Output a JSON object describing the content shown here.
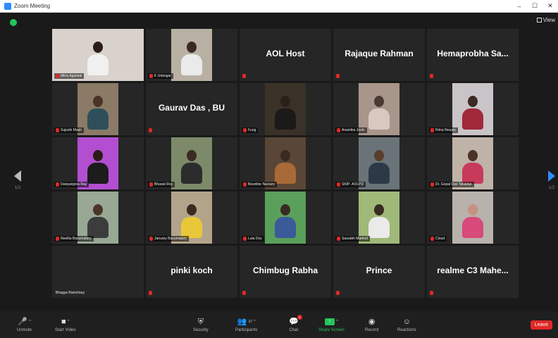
{
  "window": {
    "title": "Zoom Meeting",
    "minimize": "–",
    "maximize": "☐",
    "close": "✕"
  },
  "view_label": "View",
  "pager": {
    "left_num": "1/2",
    "right_num": "1/2"
  },
  "tiles": [
    {
      "name": "Mitra Agarwal",
      "type": "video",
      "active": true,
      "bg": "#d9d2cc",
      "body": "#f0f0f0",
      "head": "#2a1c16"
    },
    {
      "name": "K Udangar",
      "type": "video",
      "bg": "#b9b0a4",
      "body": "#eaeaea",
      "head": "#3b2a22"
    },
    {
      "name": "AOL Host",
      "type": "text"
    },
    {
      "name": "Rajaque Rahman",
      "type": "text"
    },
    {
      "name": "Hemaprobha  Sa...",
      "type": "text"
    },
    {
      "name": "Sujoshi Mash",
      "type": "video",
      "bg": "#8a7a66",
      "body": "#2e4f5a",
      "head": "#4a3426"
    },
    {
      "name": "Gaurav Das , BU",
      "type": "text"
    },
    {
      "name": "Fuog",
      "type": "video",
      "bg": "#3a3228",
      "body": "#1c1a18",
      "head": "#2a211b"
    },
    {
      "name": "Anamika Joshi",
      "type": "video",
      "bg": "#a8968a",
      "body": "#d8c8c0",
      "head": "#4a3a32"
    },
    {
      "name": "Rima Neuaty",
      "type": "video",
      "bg": "#c9c4c7",
      "body": "#a02838",
      "head": "#3a2a24"
    },
    {
      "name": "Deepanjona Ray",
      "type": "video",
      "bg": "#b24fd0",
      "body": "#1c1c1c",
      "head": "#2a1c18"
    },
    {
      "name": "Bharati Roy",
      "type": "video",
      "bg": "#7c8a6a",
      "body": "#2c2c2c",
      "head": "#3a2a22"
    },
    {
      "name": "Bewdine Narzary",
      "type": "video",
      "bg": "#5a4636",
      "body": "#a86a38",
      "head": "#3a2a20"
    },
    {
      "name": "SKIP- AOLPD",
      "type": "video",
      "bg": "#6a7478",
      "body": "#2c3a48",
      "head": "#5a3e2c"
    },
    {
      "name": "Dr. Gopal Das Talukdar",
      "type": "video",
      "bg": "#bfb3a8",
      "body": "#c83a5a",
      "head": "#4a3226"
    },
    {
      "name": "Neelita Basumatary",
      "type": "video",
      "bg": "#98a894",
      "body": "#3c3c3c",
      "head": "#4a3426"
    },
    {
      "name": "January Basumatary",
      "type": "video",
      "bg": "#b2a48a",
      "body": "#e8c838",
      "head": "#3a2a20"
    },
    {
      "name": "Lula Dey",
      "type": "video",
      "bg": "#5aa05a",
      "body": "#3a5a9a",
      "head": "#3a2a22"
    },
    {
      "name": "Saurabh Marknd",
      "type": "video",
      "bg": "#a0b878",
      "body": "#eaeaea",
      "head": "#3a2a20"
    },
    {
      "name": "Cloud",
      "type": "video",
      "bg": "#b8b2ac",
      "body": "#d84a7a",
      "head": "#c89080"
    },
    {
      "name": "Bhagya Ramchary",
      "type": "blank"
    },
    {
      "name": "pinki koch",
      "type": "text"
    },
    {
      "name": "Chimbug Rabha",
      "type": "text"
    },
    {
      "name": "Prince",
      "type": "text"
    },
    {
      "name": "realme  C3  Mahe...",
      "type": "text"
    }
  ],
  "toolbar": {
    "unmute": "Unmute",
    "start_video": "Start Video",
    "security": "Security",
    "participants": "Participants",
    "participants_count": "32",
    "chat": "Chat",
    "chat_badge": "4",
    "share_screen": "Share Screen",
    "record": "Record",
    "reactions": "Reactions",
    "leave": "Leave"
  },
  "colors": {
    "active_speaker": "#c8e23a",
    "accent": "#2d8cff",
    "leave": "#e02828",
    "share": "#23c35a"
  }
}
